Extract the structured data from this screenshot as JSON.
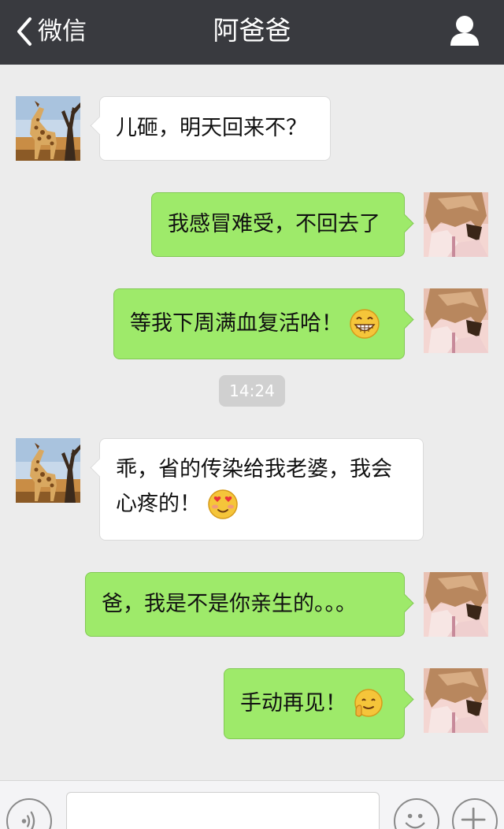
{
  "header": {
    "back_label": "微信",
    "title": "阿爸爸",
    "back_icon": "chevron-left-icon",
    "contact_icon": "person-icon"
  },
  "messages": [
    {
      "side": "in",
      "avatar": "father-avatar",
      "text": "儿砸，明天回来不？"
    },
    {
      "side": "out",
      "avatar": "me-avatar",
      "text": "我感冒难受，不回去了"
    },
    {
      "side": "out",
      "avatar": "me-avatar",
      "text": "等我下周满血复活哈！",
      "emoji": "grin-emoji"
    },
    {
      "side": "in",
      "avatar": "father-avatar",
      "lines": [
        "乖，省的传染给我老婆，我会",
        "心疼的！"
      ],
      "emoji": "heart-eyes-emoji"
    },
    {
      "side": "out",
      "avatar": "me-avatar",
      "text": "爸，我是不是你亲生的。。。"
    },
    {
      "side": "out",
      "avatar": "me-avatar",
      "text": "手动再见！",
      "emoji": "waving-emoji"
    }
  ],
  "timestamp": "14:24",
  "input": {
    "value": "",
    "placeholder": ""
  },
  "toolbar": {
    "voice_icon": "voice-icon",
    "emoji_icon": "smiley-icon",
    "more_icon": "plus-icon"
  },
  "colors": {
    "header_bg": "#393a3f",
    "background": "#ececec",
    "bubble_out": "#9eea6a",
    "bubble_in": "#ffffff",
    "time_pill": "#d0d0d0"
  }
}
